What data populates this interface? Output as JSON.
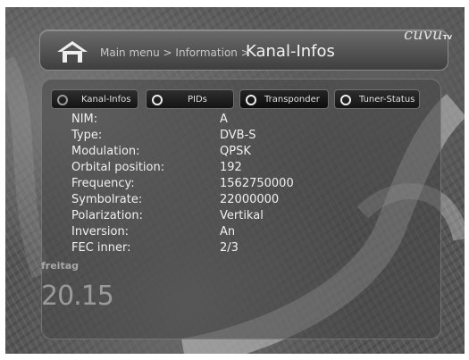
{
  "header": {
    "breadcrumb": "Main menu > Information >",
    "title": "Kanal-Infos"
  },
  "brand": {
    "logo_text": "cuvu",
    "tv_label": "TV"
  },
  "tabs": [
    {
      "label": "Kanal-Infos"
    },
    {
      "label": "PIDs"
    },
    {
      "label": "Transponder"
    },
    {
      "label": "Tuner-Status"
    }
  ],
  "info": [
    {
      "key": "NIM:",
      "value": "A"
    },
    {
      "key": "Type:",
      "value": "DVB-S"
    },
    {
      "key": "Modulation:",
      "value": "QPSK"
    },
    {
      "key": "Orbital position:",
      "value": "192"
    },
    {
      "key": "Frequency:",
      "value": "1562750000"
    },
    {
      "key": "Symbolrate:",
      "value": "22000000"
    },
    {
      "key": "Polarization:",
      "value": "Vertikal"
    },
    {
      "key": "Inversion:",
      "value": "An"
    },
    {
      "key": "FEC inner:",
      "value": "2/3"
    }
  ],
  "clock": {
    "day": "freitag",
    "time": "20.15"
  }
}
